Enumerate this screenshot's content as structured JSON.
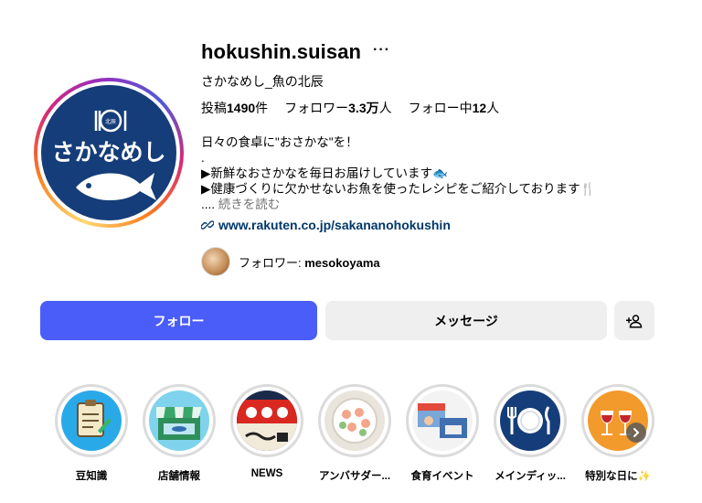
{
  "profile": {
    "username": "hokushin.suisan",
    "more": "···",
    "full_name": "さかなめし_魚の北辰",
    "avatar_text": "さかなめし",
    "avatar_logo_text": "北辰"
  },
  "stats": {
    "posts_label": "投稿",
    "posts_value": "1490",
    "posts_suffix": "件",
    "followers_label": "フォロワー",
    "followers_value": "3.3万",
    "followers_suffix": "人",
    "following_label": "フォロー中",
    "following_value": "12",
    "following_suffix": "人"
  },
  "bio": {
    "line1": "日々の食卓に\"おさかな\"を！",
    "line2": ".",
    "line3": "▶新鮮なおさかなを毎日お届けしています🐟",
    "line4": "▶健康づくりに欠かせないお魚を使ったレシピをご紹介しております🍴",
    "ellipsis": "....",
    "more_label": "続きを読む"
  },
  "link": {
    "text": "www.rakuten.co.jp/sakananohokushin"
  },
  "followed_by": {
    "prefix": "フォロワー: ",
    "name": "mesokoyama"
  },
  "buttons": {
    "follow": "フォロー",
    "message": "メッセージ",
    "add_user_icon": "person-add-icon"
  },
  "highlights": [
    {
      "label": "豆知識"
    },
    {
      "label": "店舗情報"
    },
    {
      "label": "NEWS"
    },
    {
      "label": "アンバサダー..."
    },
    {
      "label": "食育イベント"
    },
    {
      "label": "メインディッ..."
    },
    {
      "label": "特別な日に✨"
    }
  ],
  "colors": {
    "brand_navy": "#153d79",
    "follow_blue": "#4a5df9",
    "link": "#00376b"
  }
}
